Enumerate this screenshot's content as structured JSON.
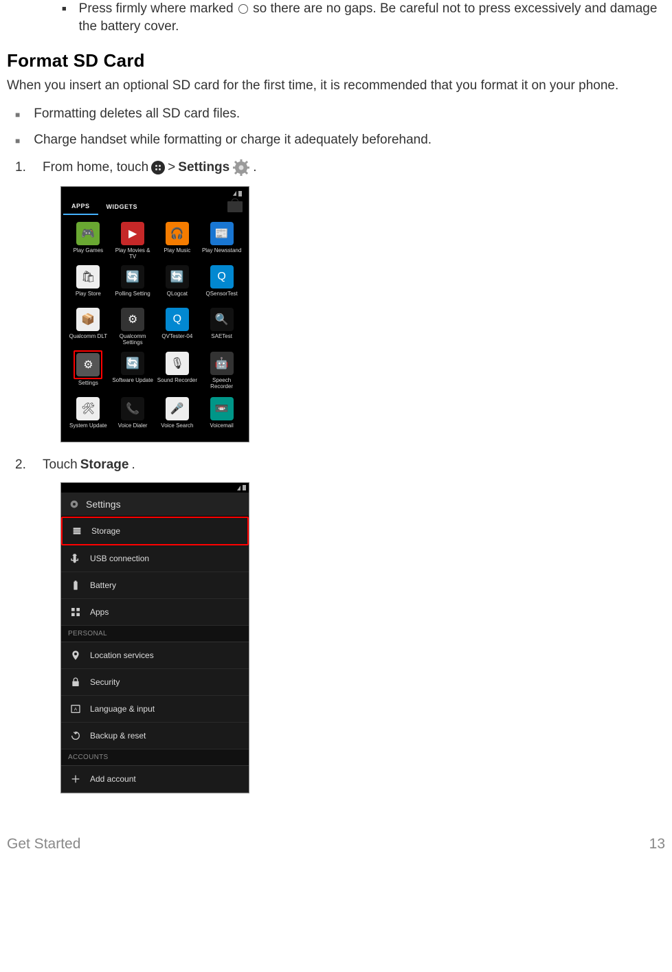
{
  "bullets_top": [
    "Press firmly where marked ○ so there are no gaps. Be careful not to press excessively and damage the battery cover."
  ],
  "heading": "Format SD Card",
  "intro": "When you insert an optional SD card for the first time, it is recommended that you format it on your phone.",
  "cautions": [
    "Formatting deletes all SD card files.",
    "Charge handset while formatting or charge it adequately beforehand."
  ],
  "steps": {
    "s1_num": "1.",
    "s1_pre": "From home, touch",
    "s1_gt": ">",
    "s1_bold": "Settings",
    "s1_dot": ".",
    "s2_num": "2.",
    "s2_pre": "Touch",
    "s2_bold": "Storage",
    "s2_dot": "."
  },
  "apps_shot": {
    "tab_apps": "APPS",
    "tab_widgets": "WIDGETS",
    "time": "",
    "grid": [
      {
        "label": "Play Games",
        "bg": "#6aa832",
        "emoji": "🎮"
      },
      {
        "label": "Play Movies & TV",
        "bg": "#c62828",
        "emoji": "▶"
      },
      {
        "label": "Play Music",
        "bg": "#f57c00",
        "emoji": "🎧"
      },
      {
        "label": "Play Newsstand",
        "bg": "#1976d2",
        "emoji": "📰"
      },
      {
        "label": "Play Store",
        "bg": "#eeeeee",
        "emoji": "🛍"
      },
      {
        "label": "Polling Setting",
        "bg": "#111",
        "emoji": "🔄"
      },
      {
        "label": "QLogcat",
        "bg": "#111",
        "emoji": "🔄"
      },
      {
        "label": "QSensorTest",
        "bg": "#0288d1",
        "emoji": "Q"
      },
      {
        "label": "Qualcomm DLT",
        "bg": "#eeeeee",
        "emoji": "📦"
      },
      {
        "label": "Qualcomm Settings",
        "bg": "#333",
        "emoji": "⚙"
      },
      {
        "label": "QVTester-04",
        "bg": "#0288d1",
        "emoji": "Q"
      },
      {
        "label": "SAETest",
        "bg": "#111",
        "emoji": "🔍"
      },
      {
        "label": "Settings",
        "bg": "#555",
        "emoji": "⚙",
        "highlight": true
      },
      {
        "label": "Software Update",
        "bg": "#111",
        "emoji": "🔄"
      },
      {
        "label": "Sound Recorder",
        "bg": "#eee",
        "emoji": "🎙"
      },
      {
        "label": "Speech Recorder",
        "bg": "#333",
        "emoji": "🤖"
      },
      {
        "label": "System Update",
        "bg": "#eee",
        "emoji": "🛠"
      },
      {
        "label": "Voice Dialer",
        "bg": "#111",
        "emoji": "📞"
      },
      {
        "label": "Voice Search",
        "bg": "#eee",
        "emoji": "🎤"
      },
      {
        "label": "Voicemail",
        "bg": "#009688",
        "emoji": "📼"
      }
    ]
  },
  "settings_shot": {
    "title": "Settings",
    "rows": [
      {
        "icon": "storage",
        "label": "Storage",
        "highlight": true
      },
      {
        "icon": "usb",
        "label": "USB connection"
      },
      {
        "icon": "battery",
        "label": "Battery"
      },
      {
        "icon": "apps",
        "label": "Apps"
      },
      {
        "section": "PERSONAL"
      },
      {
        "icon": "location",
        "label": "Location services"
      },
      {
        "icon": "security",
        "label": "Security"
      },
      {
        "icon": "language",
        "label": "Language & input"
      },
      {
        "icon": "backup",
        "label": "Backup & reset"
      },
      {
        "section": "ACCOUNTS"
      },
      {
        "icon": "add",
        "label": "Add account"
      }
    ]
  },
  "footer": {
    "left": "Get Started",
    "right": "13"
  }
}
